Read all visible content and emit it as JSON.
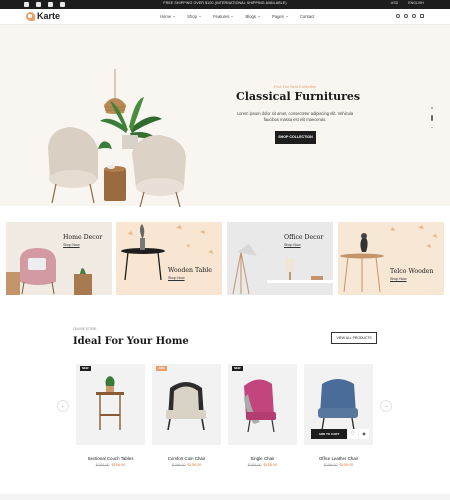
{
  "topbar": {
    "promo": "FREE SHIPPING OVER $100 (INTERNATIONAL SHIPPING AVAILABLE)",
    "currency": "USD",
    "language": "ENGLISH",
    "social": [
      "facebook-icon",
      "twitter-icon",
      "youtube-icon",
      "instagram-icon"
    ]
  },
  "header": {
    "logo": "Karte",
    "nav": [
      {
        "label": "Home"
      },
      {
        "label": "Shop"
      },
      {
        "label": "Features"
      },
      {
        "label": "Blogs"
      },
      {
        "label": "Pages"
      },
      {
        "label": "Contact"
      }
    ],
    "icons": [
      "search-icon",
      "user-icon",
      "wishlist-icon",
      "cart-icon"
    ]
  },
  "hero": {
    "subtitle": "Find The Best Collection",
    "title": "Classical Furnitures",
    "description": "Lorem ipsum dolor sit amet, consectetur adipiscing elit. Vehicula faucibus massa est elit maecenas.",
    "cta": "SHOP COLLECTION"
  },
  "banners": [
    {
      "title": "Home Decor",
      "link": "Shop Now"
    },
    {
      "title": "Wooden Table",
      "link": "Shop Now"
    },
    {
      "title": "Office Decor",
      "link": "Shop Now"
    },
    {
      "title": "Telco Wooden",
      "link": "Shop Now"
    }
  ],
  "products_section": {
    "kicker": "ONLINE STORE",
    "title": "Ideal For Your Home",
    "view_all": "VIEW ALL PRODUCTS"
  },
  "products": [
    {
      "badge": "NEW",
      "badge_color": "#1d1d1d",
      "category": "",
      "name": "Sectional Couch Tables",
      "old_price": "$189.00",
      "new_price": "$159.00"
    },
    {
      "badge": "-16%",
      "badge_color": "#e8a06d",
      "category": "",
      "name": "Comfort Coin Chair",
      "old_price": "$189.00",
      "new_price": "$159.00"
    },
    {
      "badge": "NEW",
      "badge_color": "#1d1d1d",
      "category": "",
      "name": "Single Chair",
      "old_price": "$189.00",
      "new_price": "$159.00"
    },
    {
      "badge": "",
      "badge_color": "#1d1d1d",
      "category": "",
      "name": "Office Leather Chair",
      "old_price": "$189.00",
      "new_price": "$159.00",
      "add_to_cart": "ADD TO CART"
    }
  ],
  "colors": {
    "accent": "#e8a06d",
    "dark": "#1d1d1d",
    "hero_bg": "#f9f6f1"
  }
}
